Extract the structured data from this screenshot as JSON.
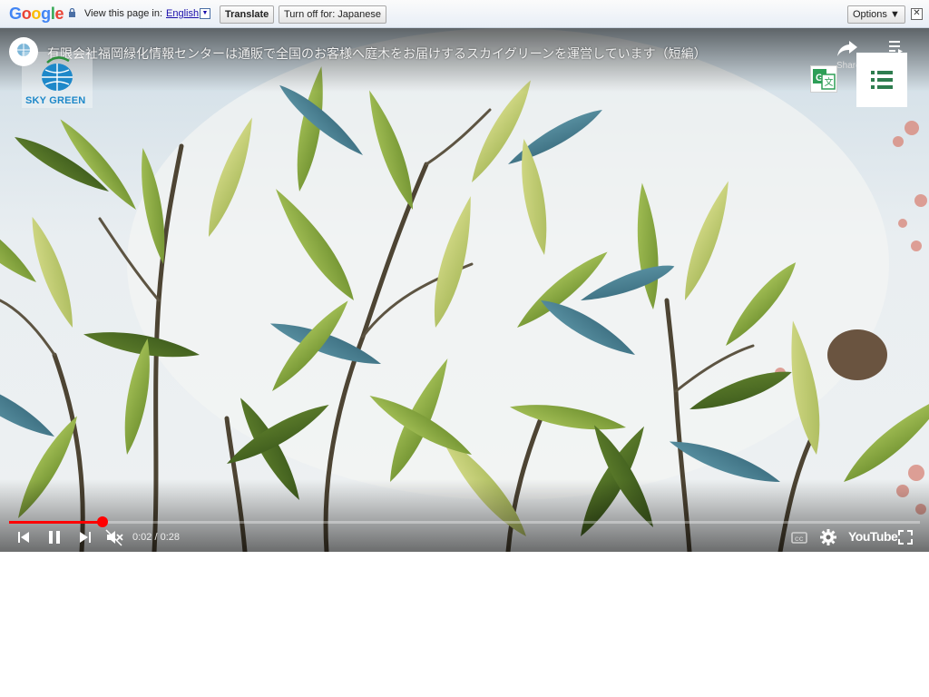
{
  "translate_bar": {
    "logo_letters": [
      "G",
      "o",
      "o",
      "g",
      "l",
      "e"
    ],
    "logo_colors": [
      "#4285f4",
      "#ea4335",
      "#fbbc05",
      "#4285f4",
      "#34a853",
      "#ea4335"
    ],
    "view_label": "View this page in:",
    "language": "English",
    "language_caret": "▼",
    "translate_button": "Translate",
    "turn_off_button": "Turn off for: Japanese",
    "options_button": "Options ▼",
    "close_glyph": "✕"
  },
  "video": {
    "title": "有限会社福岡緑化情報センターは通販で全国のお客様へ庭木をお届けするスカイグリーンを運営しています（短編）",
    "share_label": "Share",
    "brand_logo_text": "SKY GREEN",
    "time_display": "0:02 / 0:28",
    "progress_fraction": 0.103,
    "youtube_wordmark": "YouTube",
    "progress_color": "#ff0000"
  },
  "icons": {
    "lock": "lock-icon",
    "share": "share-icon",
    "playlist": "playlist-icon",
    "translate_gx": "google-translate-icon",
    "menu": "list-menu-icon",
    "prev": "previous-icon",
    "pause": "pause-icon",
    "next": "next-icon",
    "mute": "muted-volume-icon",
    "cc": "captions-icon",
    "settings": "gear-icon",
    "fullscreen": "fullscreen-icon"
  }
}
